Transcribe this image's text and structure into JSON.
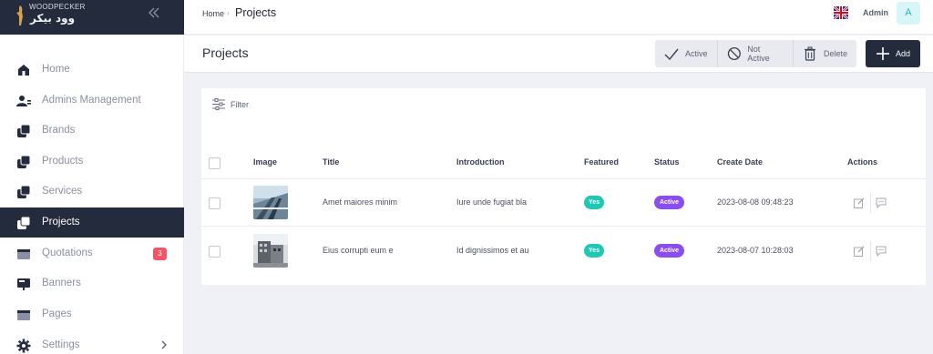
{
  "brand": {
    "name_en": "WOODPECKER",
    "name_ar": "وود بيكر"
  },
  "sidebar": {
    "items": [
      {
        "label": "Home",
        "icon": "home-icon"
      },
      {
        "label": "Admins Management",
        "icon": "admins-icon"
      },
      {
        "label": "Brands",
        "icon": "brands-icon"
      },
      {
        "label": "Products",
        "icon": "products-icon"
      },
      {
        "label": "Services",
        "icon": "services-icon"
      },
      {
        "label": "Projects",
        "icon": "projects-icon",
        "active": true
      },
      {
        "label": "Quotations",
        "icon": "quotations-icon",
        "badge": "3"
      },
      {
        "label": "Banners",
        "icon": "banners-icon"
      },
      {
        "label": "Pages",
        "icon": "pages-icon"
      },
      {
        "label": "Settings",
        "icon": "settings-icon",
        "has_submenu": true
      }
    ]
  },
  "topbar": {
    "breadcrumb_home": "Home",
    "breadcrumb_separator": "›",
    "breadcrumb_current": "Projects",
    "language_flag": "uk-flag-icon",
    "user_name": "Admin",
    "avatar_initial": "A"
  },
  "page": {
    "title": "Projects",
    "actions": {
      "active_label": "Active",
      "not_active_label": "Not Active",
      "delete_label": "Delete",
      "add_label": "Add"
    }
  },
  "table": {
    "filter_label": "Filter",
    "columns": {
      "image": "Image",
      "title": "Title",
      "introduction": "Introduction",
      "featured": "Featured",
      "status": "Status",
      "create_date": "Create Date",
      "actions": "Actions"
    },
    "rows": [
      {
        "title": "Amet maiores minim",
        "introduction": "Iure unde fugiat bla",
        "featured": "Yes",
        "status": "Active",
        "create_date": "2023-08-08 09:48:23"
      },
      {
        "title": "Eius corrupti eum e",
        "introduction": "Id dignissimos et au",
        "featured": "Yes",
        "status": "Active",
        "create_date": "2023-08-07 10:28:03"
      }
    ]
  },
  "colors": {
    "sidebar_dark": "#242b3d",
    "featured_yes": "#1fc7b5",
    "status_active": "#8a4df0",
    "badge_red": "#f25567",
    "avatar_bg": "#d8f6f7"
  }
}
